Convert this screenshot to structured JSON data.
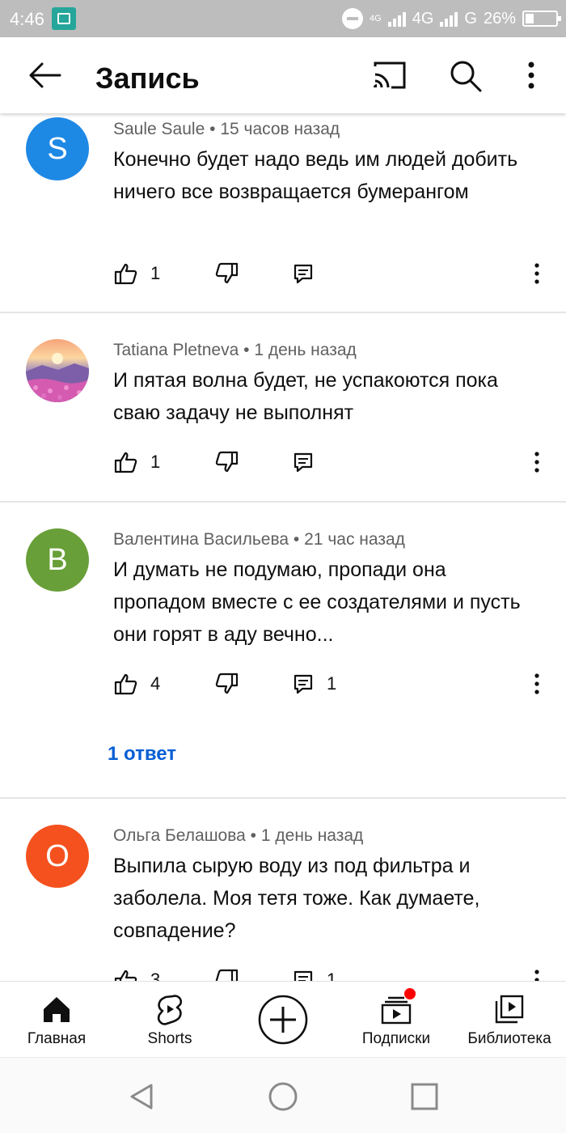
{
  "status_bar": {
    "time": "4:46",
    "network_small": "4G",
    "network_1": "4G",
    "network_2": "G",
    "battery": "26%"
  },
  "header": {
    "title": "Запись"
  },
  "comments": [
    {
      "author": "Saule Saule",
      "time": "15 часов назад",
      "avatar_letter": "S",
      "avatar_color": "#1e88e5",
      "text": "Конечно будет надо ведь им людей добить ничего все возвращается бумерангом",
      "likes": "1",
      "replies_count": ""
    },
    {
      "author": "Tatiana Pletneva",
      "time": "1 день назад",
      "avatar_letter": "",
      "avatar_color": "#b56aa6",
      "text": "И пятая волна будет, не успакоются пока сваю задачу не выполнят",
      "likes": "1",
      "replies_count": ""
    },
    {
      "author": "Валентина Васильева",
      "time": "21 час назад",
      "avatar_letter": "В",
      "avatar_color": "#689f38",
      "text": "И думать не подумаю, пропади она пропадом вместе с ее создателями и пусть они горят в аду вечно...",
      "likes": "4",
      "replies_count": "1",
      "replies_link": "1 ответ"
    },
    {
      "author": "Ольга Белашова",
      "time": "1 день назад",
      "avatar_letter": "О",
      "avatar_color": "#f4511e",
      "text": "Выпила сырую воду из под фильтра и заболела. Моя тетя тоже. Как думаете, совпадение?",
      "likes": "3",
      "replies_count": "1"
    }
  ],
  "meta_separator": "•",
  "bottom_nav": {
    "home": "Главная",
    "shorts": "Shorts",
    "subscriptions": "Подписки",
    "library": "Библиотека",
    "notification_dot_color": "#ff0000"
  },
  "colors": {
    "link": "#065fd4",
    "secondary_text": "#606060"
  }
}
